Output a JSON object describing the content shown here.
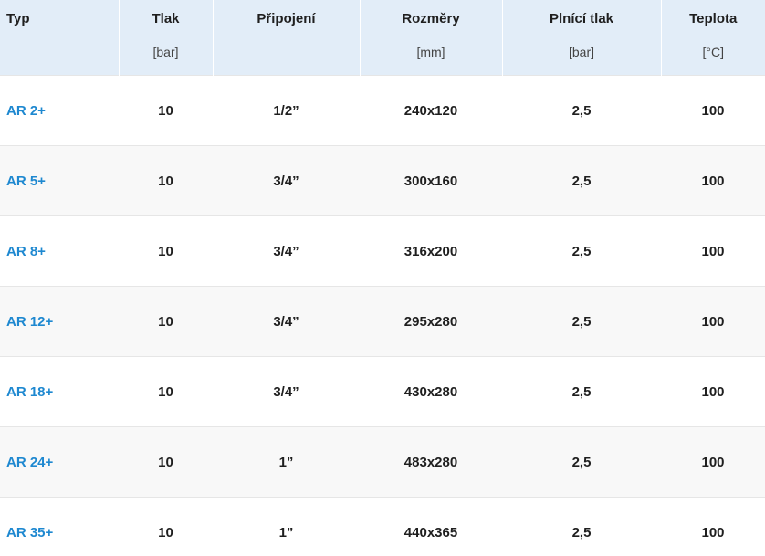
{
  "colors": {
    "header_background": "#e2edf8",
    "link": "#1e88d0",
    "row_alt_background": "#f8f8f8",
    "text": "#1f1f1f"
  },
  "table": {
    "headers": [
      {
        "title": "Typ",
        "unit": ""
      },
      {
        "title": "Tlak",
        "unit": "[bar]"
      },
      {
        "title": "Připojení",
        "unit": ""
      },
      {
        "title": "Rozměry",
        "unit": "[mm]"
      },
      {
        "title": "Plnící tlak",
        "unit": "[bar]"
      },
      {
        "title": "Teplota",
        "unit": "[°C]"
      }
    ],
    "rows": [
      {
        "type": "AR 2+",
        "pressure": "10",
        "connection": "1/2”",
        "dimensions": "240x120",
        "fill_pressure": "2,5",
        "temperature": "100"
      },
      {
        "type": "AR 5+",
        "pressure": "10",
        "connection": "3/4”",
        "dimensions": "300x160",
        "fill_pressure": "2,5",
        "temperature": "100"
      },
      {
        "type": "AR 8+",
        "pressure": "10",
        "connection": "3/4”",
        "dimensions": "316x200",
        "fill_pressure": "2,5",
        "temperature": "100"
      },
      {
        "type": "AR 12+",
        "pressure": "10",
        "connection": "3/4”",
        "dimensions": "295x280",
        "fill_pressure": "2,5",
        "temperature": "100"
      },
      {
        "type": "AR 18+",
        "pressure": "10",
        "connection": "3/4”",
        "dimensions": "430x280",
        "fill_pressure": "2,5",
        "temperature": "100"
      },
      {
        "type": "AR 24+",
        "pressure": "10",
        "connection": "1”",
        "dimensions": "483x280",
        "fill_pressure": "2,5",
        "temperature": "100"
      },
      {
        "type": "AR 35+",
        "pressure": "10",
        "connection": "1”",
        "dimensions": "440x365",
        "fill_pressure": "2,5",
        "temperature": "100"
      }
    ]
  }
}
